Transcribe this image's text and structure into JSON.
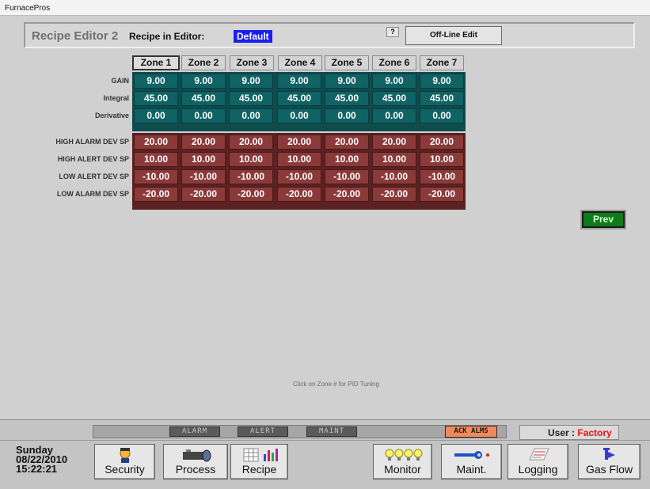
{
  "app": {
    "title": "FurnacePros"
  },
  "header": {
    "title": "Recipe Editor 2",
    "recipe_label": "Recipe in Editor:",
    "recipe_name": "Default",
    "help_label": "?",
    "offline_edit_label": "Off-Line Edit"
  },
  "zones": [
    "Zone 1",
    "Zone 2",
    "Zone 3",
    "Zone 4",
    "Zone 5",
    "Zone 6",
    "Zone 7"
  ],
  "selected_zone": "Zone 1",
  "rows": [
    {
      "label": "GAIN",
      "group": "pid",
      "values": [
        "9.00",
        "9.00",
        "9.00",
        "9.00",
        "9.00",
        "9.00",
        "9.00"
      ]
    },
    {
      "label": "Integral",
      "group": "pid",
      "values": [
        "45.00",
        "45.00",
        "45.00",
        "45.00",
        "45.00",
        "45.00",
        "45.00"
      ]
    },
    {
      "label": "Derivative",
      "group": "pid",
      "values": [
        "0.00",
        "0.00",
        "0.00",
        "0.00",
        "0.00",
        "0.00",
        "0.00"
      ]
    },
    {
      "label": "HIGH ALARM DEV SP",
      "group": "alarm",
      "values": [
        "20.00",
        "20.00",
        "20.00",
        "20.00",
        "20.00",
        "20.00",
        "20.00"
      ]
    },
    {
      "label": "HIGH ALERT DEV SP",
      "group": "alarm",
      "values": [
        "10.00",
        "10.00",
        "10.00",
        "10.00",
        "10.00",
        "10.00",
        "10.00"
      ]
    },
    {
      "label": "LOW ALERT DEV SP",
      "group": "alarm",
      "values": [
        "-10.00",
        "-10.00",
        "-10.00",
        "-10.00",
        "-10.00",
        "-10.00",
        "-10.00"
      ]
    },
    {
      "label": "LOW ALARM DEV SP",
      "group": "alarm",
      "values": [
        "-20.00",
        "-20.00",
        "-20.00",
        "-20.00",
        "-20.00",
        "-20.00",
        "-20.00"
      ]
    }
  ],
  "prev_label": "Prev",
  "hint": "Click on Zone # for PID Tuning",
  "status": {
    "alarm": "ALARM",
    "alert": "ALERT",
    "maint": "MAINT",
    "ack_alarms": "ACK ALMS",
    "user_label": "User :",
    "user_value": "Factory"
  },
  "datetime": {
    "day": "Sunday",
    "date": "08/22/2010",
    "time": "15:22:21"
  },
  "nav": [
    {
      "label": "Security",
      "icon": "security-icon"
    },
    {
      "label": "Process",
      "icon": "process-icon"
    },
    {
      "label": "Recipe",
      "icon": "recipe-icon"
    },
    {
      "label": "Monitor",
      "icon": "monitor-icon"
    },
    {
      "label": "Maint.",
      "icon": "wrench-icon"
    },
    {
      "label": "Logging",
      "icon": "logging-icon"
    },
    {
      "label": "Gas Flow",
      "icon": "gas-valve-icon"
    }
  ],
  "colors": {
    "pid_cell": "#106264",
    "alarm_cell": "#8b3a3a",
    "recipe_name_bg": "#1b1ef0",
    "prev_button": "#0d7d1a",
    "ack_button": "#f18a5a",
    "user_value": "#ee1111"
  }
}
